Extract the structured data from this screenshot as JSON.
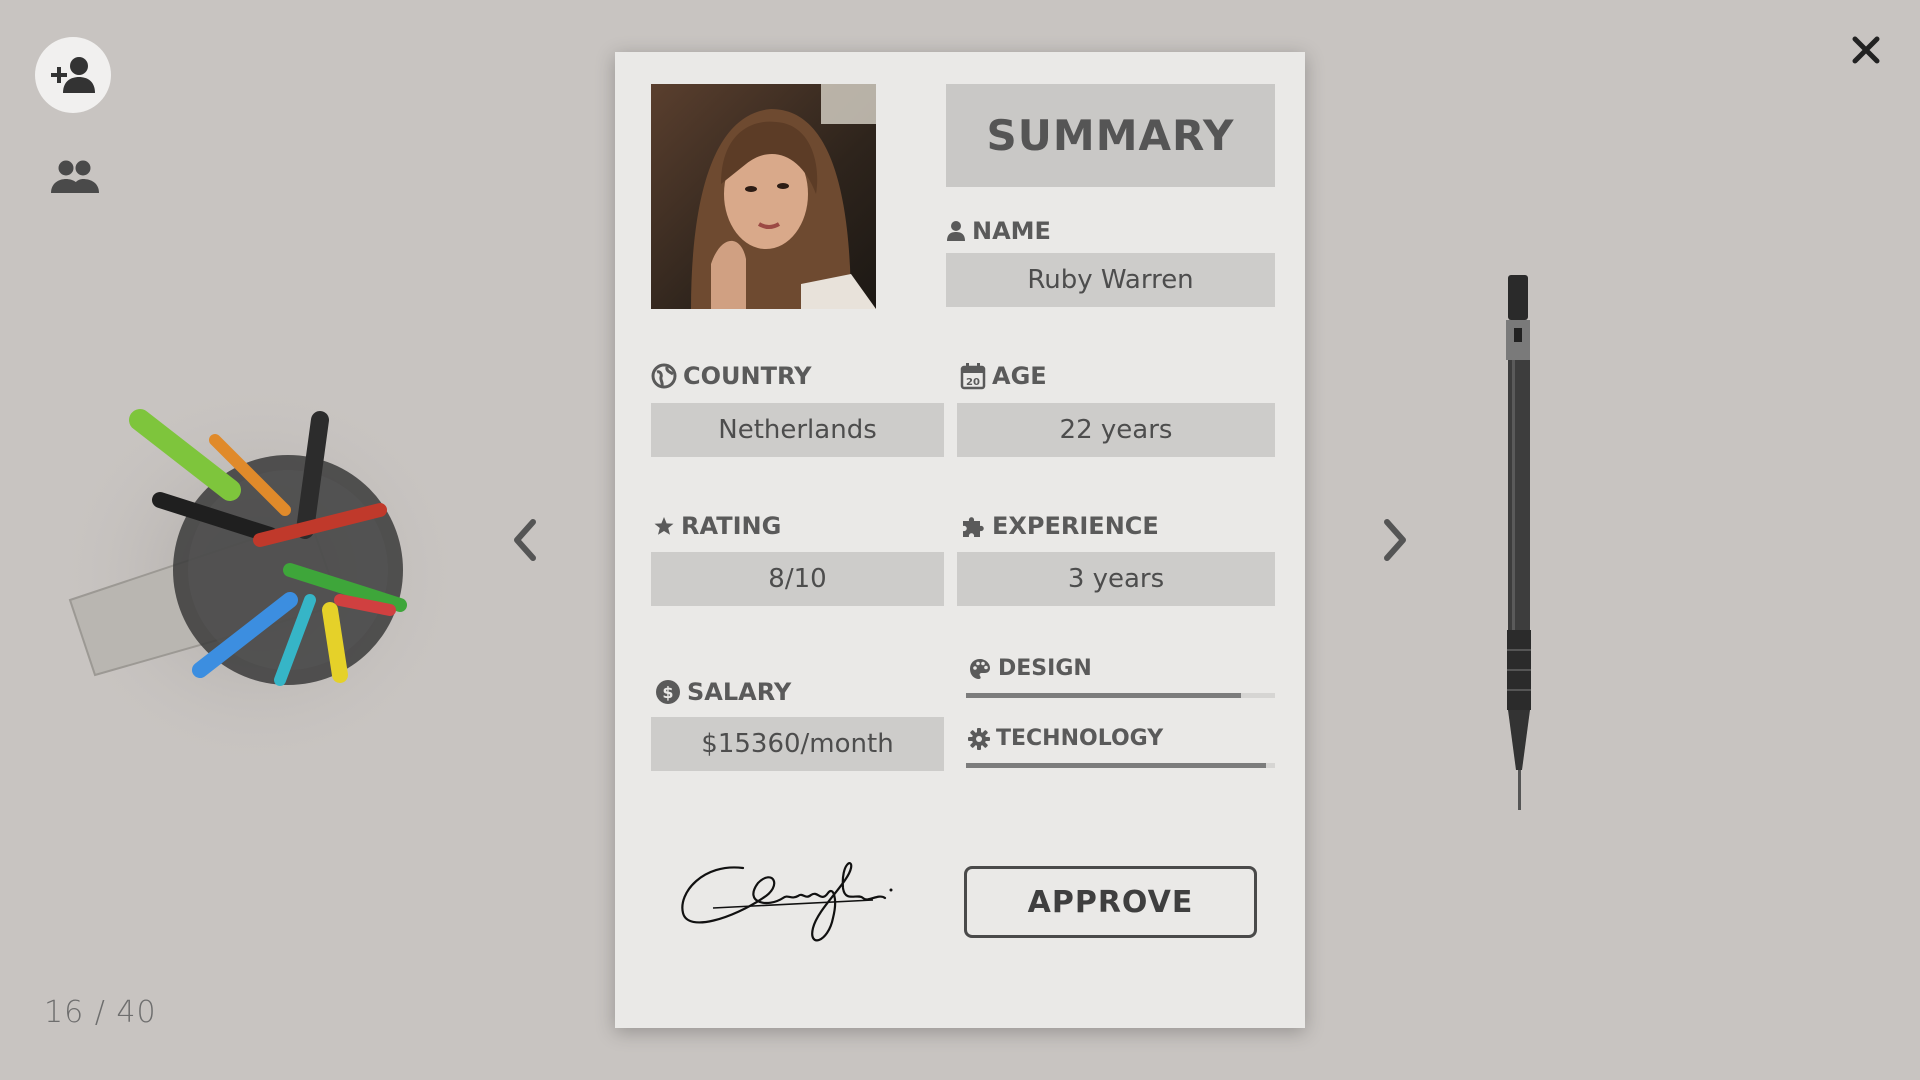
{
  "toolbar": {
    "add_icon": "person-add-icon",
    "group_icon": "people-group-icon",
    "close_icon": "close-icon"
  },
  "navigation": {
    "counter": "16 / 40",
    "prev_icon": "chevron-left-icon",
    "next_icon": "chevron-right-icon"
  },
  "card": {
    "title": "SUMMARY",
    "name_label": "NAME",
    "name_value": "Ruby Warren",
    "country_label": "COUNTRY",
    "country_value": "Netherlands",
    "age_label": "AGE",
    "age_value": "22 years",
    "rating_label": "RATING",
    "rating_value": "8/10",
    "experience_label": "EXPERIENCE",
    "experience_value": "3 years",
    "salary_label": "SALARY",
    "salary_value": "$15360/month",
    "skills": [
      {
        "label": "DESIGN",
        "level": 0.89,
        "icon": "palette-icon"
      },
      {
        "label": "TECHNOLOGY",
        "level": 0.97,
        "icon": "gear-icon"
      }
    ],
    "approve_label": "APPROVE"
  },
  "colors": {
    "background": "#c8c4c1",
    "card": "#eae9e7",
    "field": "#cdccca",
    "bar_fill": "#7c7c7c"
  }
}
